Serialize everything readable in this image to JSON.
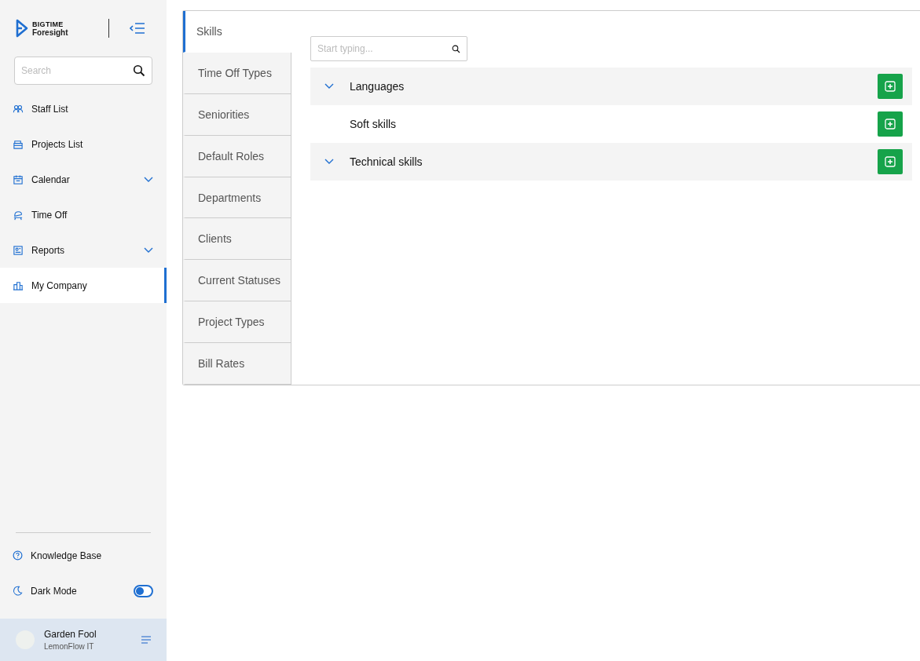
{
  "brand": {
    "name": "BIGTIME",
    "product": "Foresight"
  },
  "sidebar": {
    "search": {
      "placeholder": "Search"
    },
    "items": [
      {
        "label": "Staff List",
        "kind": "link",
        "selected": false
      },
      {
        "label": "Projects List",
        "kind": "link",
        "selected": false
      },
      {
        "label": "Calendar",
        "kind": "group",
        "selected": false
      },
      {
        "label": "Time Off",
        "kind": "link",
        "selected": false
      },
      {
        "label": "Reports",
        "kind": "group",
        "selected": false
      },
      {
        "label": "My Company",
        "kind": "link",
        "selected": true
      }
    ],
    "bottom": [
      {
        "label": "Knowledge Base",
        "kind": "link"
      },
      {
        "label": "Dark Mode",
        "kind": "toggle",
        "on": false
      }
    ],
    "user": {
      "name": "Garden Fool",
      "company": "LemonFlow IT"
    }
  },
  "tabs": [
    {
      "label": "Skills",
      "selected": true
    },
    {
      "label": "Time Off Types",
      "selected": false
    },
    {
      "label": "Seniorities",
      "selected": false
    },
    {
      "label": "Default Roles",
      "selected": false
    },
    {
      "label": "Departments",
      "selected": false
    },
    {
      "label": "Clients",
      "selected": false
    },
    {
      "label": "Current Statuses",
      "selected": false
    },
    {
      "label": "Project Types",
      "selected": false
    },
    {
      "label": "Bill Rates",
      "selected": false
    }
  ],
  "filter": {
    "placeholder": "Start typing..."
  },
  "skill_groups": [
    {
      "name": "Languages",
      "expandable": true
    },
    {
      "name": "Soft skills",
      "expandable": false
    },
    {
      "name": "Technical skills",
      "expandable": true
    }
  ]
}
